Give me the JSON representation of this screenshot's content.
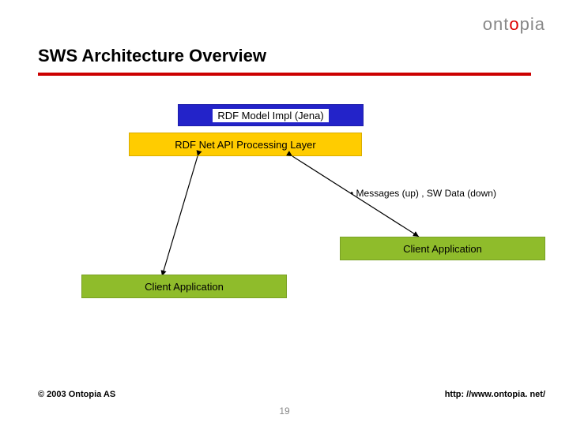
{
  "logo": {
    "part1": "ont",
    "accent": "o",
    "part2": "pia"
  },
  "title": "SWS Architecture Overview",
  "boxes": {
    "rdf_model": "RDF Model Impl (Jena)",
    "rdf_net": "RDF Net API Processing Layer",
    "client1": "Client Application",
    "client2": "Client Application"
  },
  "labels": {
    "messages_prefix": "• ",
    "messages": "Messages (up) , SW Data (down)"
  },
  "footer": {
    "copyright": "© 2003 Ontopia AS",
    "url": "http: //www.ontopia. net/",
    "page": "19"
  }
}
